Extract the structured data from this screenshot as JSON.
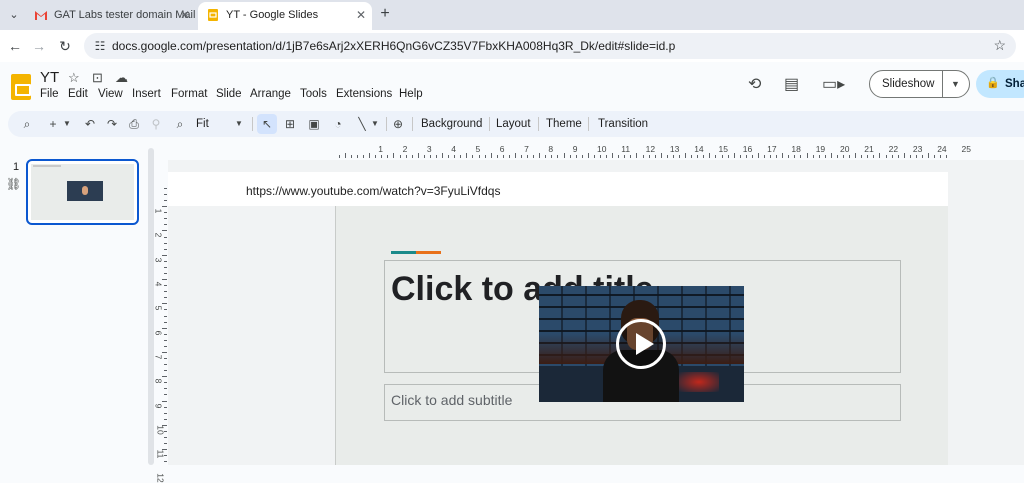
{
  "browser": {
    "tabs": [
      {
        "label": "GAT Labs tester domain Mail",
        "icon": "gmail-icon",
        "active": false
      },
      {
        "label": "YT - Google Slides",
        "icon": "slides-icon",
        "active": true
      }
    ],
    "new_tab_symbol": "+",
    "close_symbol": "✕",
    "url": "docs.google.com/presentation/d/1jB7e6sArj2xXERH6QnG6vCZ35V7FbxKHA008Hq3R_Dk/edit#slide=id.p"
  },
  "doc": {
    "title": "YT",
    "menu": [
      "File",
      "Edit",
      "View",
      "Insert",
      "Format",
      "Slide",
      "Arrange",
      "Tools",
      "Extensions",
      "Help"
    ],
    "slideshow_label": "Slideshow",
    "share_label": "Sha"
  },
  "toolbar": {
    "zoom": "Fit",
    "background_label": "Background",
    "layout_label": "Layout",
    "theme_label": "Theme",
    "transition_label": "Transition"
  },
  "filmstrip": {
    "slide_number": "1"
  },
  "rulers": {
    "horizontal": [
      "1",
      "2",
      "3",
      "4",
      "5",
      "6",
      "7",
      "8",
      "9",
      "10",
      "11",
      "12",
      "13",
      "14",
      "15",
      "16",
      "17",
      "18",
      "19",
      "20",
      "21",
      "22",
      "23",
      "24",
      "25"
    ],
    "vertical": [
      "1",
      "2",
      "3",
      "4",
      "5",
      "6",
      "7",
      "8",
      "9",
      "10",
      "11",
      "12"
    ]
  },
  "slide": {
    "link_text": "https://www.youtube.com/watch?v=3FyuLiVfdqs",
    "title_placeholder": "Click to add title",
    "subtitle_placeholder": "Click to add subtitle",
    "accent_colors": [
      "#1a8a8a",
      "#e8711a"
    ]
  },
  "colors": {
    "accent": "#0b57d0",
    "share_bg": "#c2e7ff",
    "slides_brand": "#f4b400"
  }
}
